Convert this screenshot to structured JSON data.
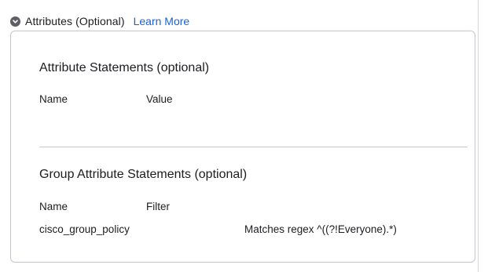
{
  "section": {
    "title": "Attributes (Optional)",
    "learn_more": "Learn More"
  },
  "attribute_statements": {
    "title": "Attribute Statements (optional)",
    "columns": {
      "name": "Name",
      "value": "Value"
    },
    "rows": []
  },
  "group_attribute_statements": {
    "title": "Group Attribute Statements (optional)",
    "columns": {
      "name": "Name",
      "filter": "Filter"
    },
    "rows": [
      {
        "name": "cisco_group_policy",
        "filter": "Matches regex ^((?!Everyone).*)"
      }
    ]
  },
  "colors": {
    "link": "#1662dd",
    "text": "#1d1d21",
    "border": "#c6c6cc",
    "chevron_bg": "#5e5e66"
  },
  "icons": {
    "collapse": "chevron-down-icon"
  }
}
